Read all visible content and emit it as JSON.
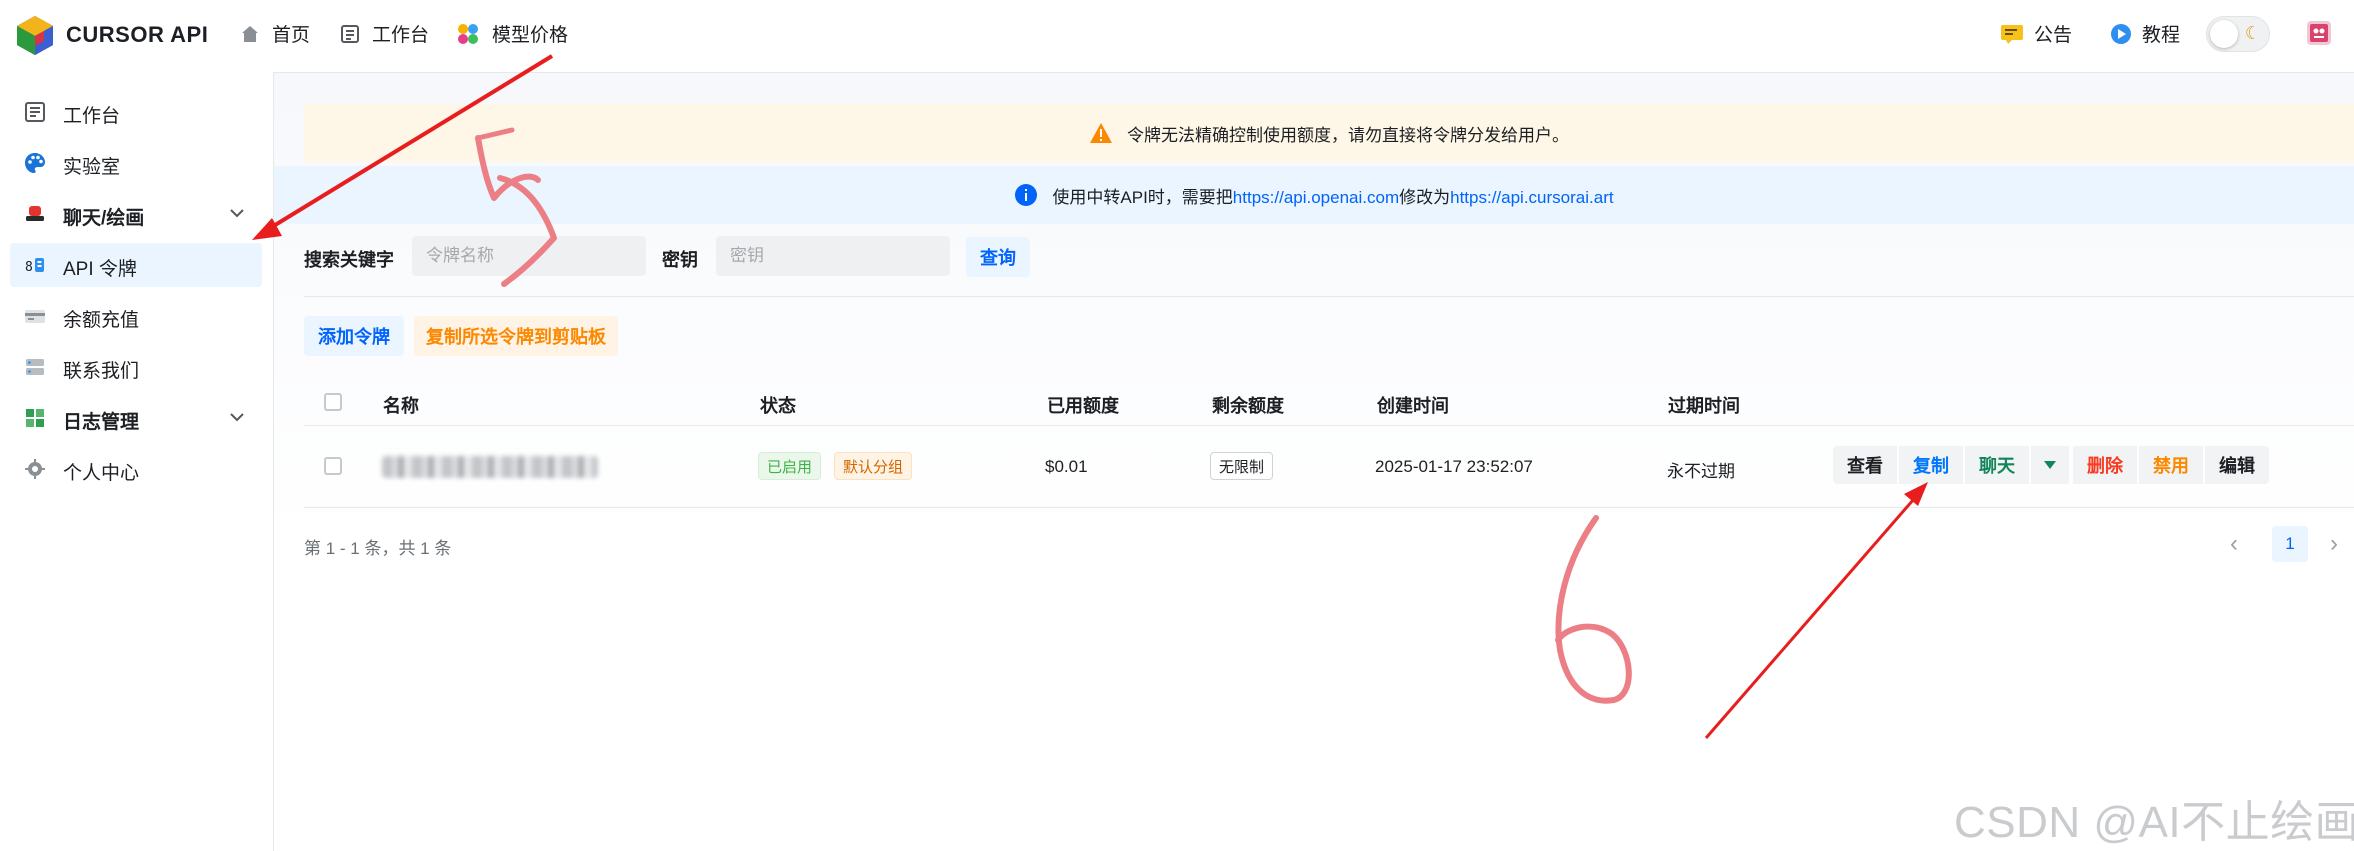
{
  "brand": {
    "name": "CURSOR API"
  },
  "topnav": [
    {
      "label": "首页",
      "icon": "home-icon"
    },
    {
      "label": "工作台",
      "icon": "dashboard-icon"
    },
    {
      "label": "模型价格",
      "icon": "palette-dots-icon"
    }
  ],
  "topright": {
    "announcement": "公告",
    "tutorial": "教程"
  },
  "sidebar": {
    "items": [
      {
        "label": "工作台",
        "icon": "dashboard-icon"
      },
      {
        "label": "实验室",
        "icon": "palette-icon"
      },
      {
        "label": "聊天/绘画",
        "icon": "chat-icon",
        "group": true
      },
      {
        "label": "API 令牌",
        "icon": "key-icon",
        "active": true
      },
      {
        "label": "余额充值",
        "icon": "credit-card-icon"
      },
      {
        "label": "联系我们",
        "icon": "server-icon"
      },
      {
        "label": "日志管理",
        "icon": "grid-icon",
        "group": true
      },
      {
        "label": "个人中心",
        "icon": "gear-icon"
      }
    ]
  },
  "banners": {
    "warning": "令牌无法精确控制使用额度，请勿直接将令牌分发给用户。",
    "info_prefix": "使用中转API时，需要把",
    "info_link1": "https://api.openai.com",
    "info_middle": "修改为",
    "info_link2": "https://api.cursorai.art"
  },
  "search": {
    "keyword_label": "搜索关键字",
    "keyword_placeholder": "令牌名称",
    "secret_label": "密钥",
    "secret_placeholder": "密钥",
    "query_button": "查询"
  },
  "toolbar": {
    "add_token": "添加令牌",
    "copy_selected": "复制所选令牌到剪贴板"
  },
  "table": {
    "headers": [
      "名称",
      "状态",
      "已用额度",
      "剩余额度",
      "创建时间",
      "过期时间"
    ],
    "rows": [
      {
        "status": "已启用",
        "group": "默认分组",
        "used": "$0.01",
        "remaining": "无限制",
        "created": "2025-01-17 23:52:07",
        "expires": "永不过期",
        "actions": [
          "查看",
          "复制",
          "聊天",
          "删除",
          "禁用",
          "编辑"
        ]
      }
    ]
  },
  "pagination": {
    "summary": "第 1 - 1 条，共 1 条",
    "current": "1"
  },
  "annotations": {
    "number_5": "5",
    "number_6": "6"
  },
  "watermark": "CSDN @AI不止绘画",
  "colors": {
    "accent": "#0064fa",
    "copy": "#0077fa",
    "chat": "#13855b",
    "delete": "#f93920",
    "disable": "#fc8800",
    "annotation": "#e8504f"
  }
}
